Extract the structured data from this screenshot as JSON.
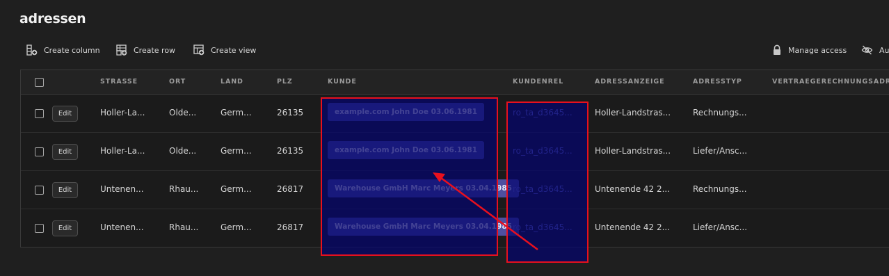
{
  "page": {
    "title": "adressen"
  },
  "toolbar": {
    "create_column": "Create column",
    "create_row": "Create row",
    "create_view": "Create view",
    "manage_access": "Manage access",
    "auto_label": "Au"
  },
  "table": {
    "columns": [
      "STRASSE",
      "ORT",
      "LAND",
      "PLZ",
      "KUNDE",
      "KUNDENREL",
      "ADRESSANZEIGE",
      "ADRESSTYP",
      "VERTRAEGERECHNUNGSADRESS"
    ],
    "edit_label": "Edit",
    "rows": [
      {
        "strasse": "Holler-La...",
        "ort": "Olde...",
        "land": "Germ...",
        "plz": "26135",
        "kunde": "example.com John Doe 03.06.1981",
        "kundenrel": "ro_ta_d3645...",
        "adressanzeige": "Holler-Landstras...",
        "adresstyp": "Rechnungs..."
      },
      {
        "strasse": "Holler-La...",
        "ort": "Olde...",
        "land": "Germ...",
        "plz": "26135",
        "kunde": "example.com John Doe 03.06.1981",
        "kundenrel": "ro_ta_d3645...",
        "adressanzeige": "Holler-Landstras...",
        "adresstyp": "Liefer/Ansc..."
      },
      {
        "strasse": "Untenen...",
        "ort": "Rhau...",
        "land": "Germ...",
        "plz": "26817",
        "kunde": "Warehouse GmbH Marc Meyers 03.04.1985",
        "kundenrel": "ro_ta_d3645...",
        "adressanzeige": "Untenende 42 2...",
        "adresstyp": "Rechnungs..."
      },
      {
        "strasse": "Untenen...",
        "ort": "Rhau...",
        "land": "Germ...",
        "plz": "26817",
        "kunde": "Warehouse GmbH Marc Meyers 03.04.1985",
        "kundenrel": "ro_ta_d3645...",
        "adressanzeige": "Untenende 42 2...",
        "adresstyp": "Liefer/Ansc..."
      }
    ]
  },
  "annotation": {
    "highlight_color": "#e8101e",
    "fill_color": "#04046e"
  }
}
